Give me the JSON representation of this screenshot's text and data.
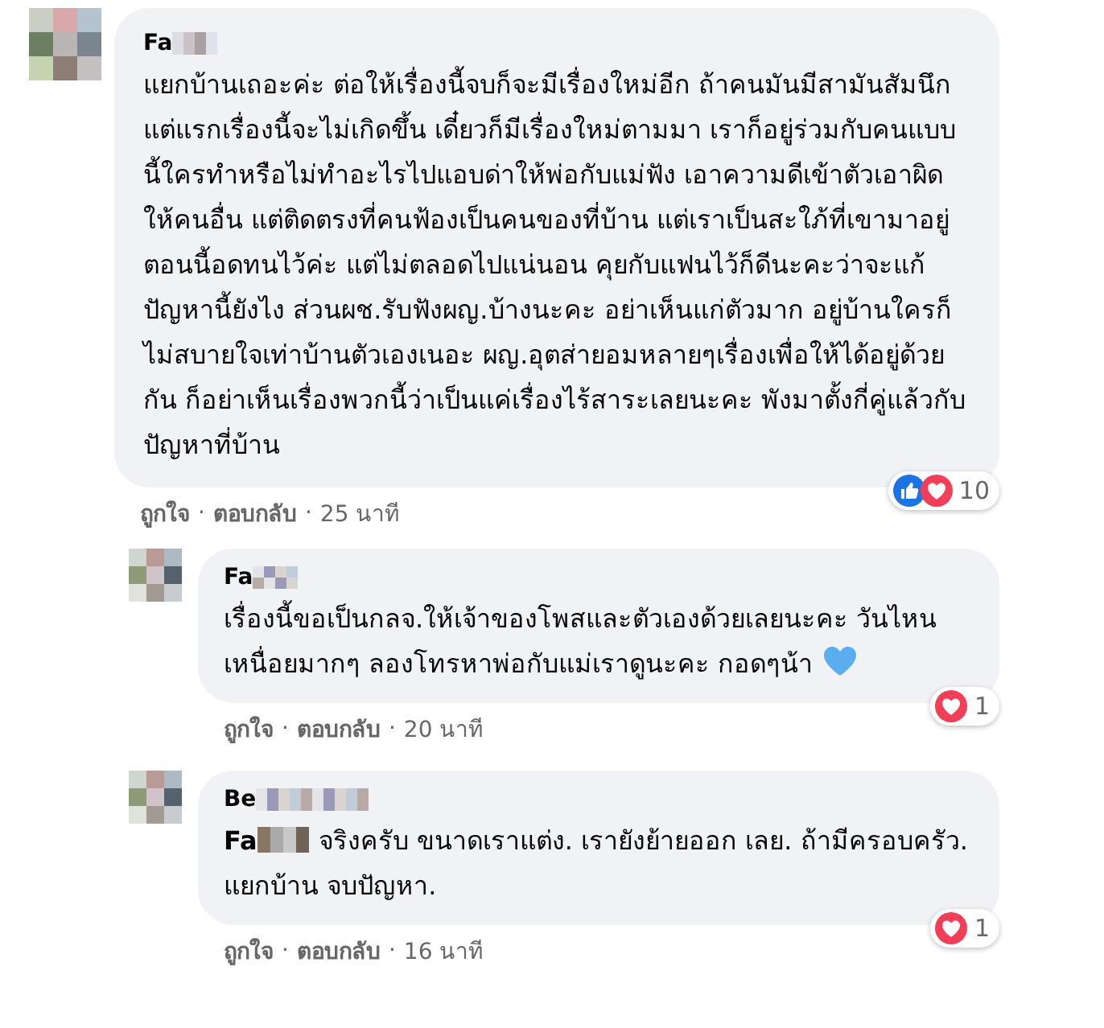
{
  "comments": [
    {
      "author": "Fa",
      "text": "แยกบ้านเถอะค่ะ ต่อให้เรื่องนี้จบก็จะมีเรื่องใหม่อีก ถ้าคนมันมีสามันสัมนึกแต่แรกเรื่องนี้จะไม่เกิดขึ้น เดี๋ยวก็มีเรื่องใหม่ตามมา เราก็อยู่ร่วมกับคนแบบนี้ใครทำหรือไม่ทำอะไรไปแอบด่าให้พ่อกับแม่ฟัง เอาความดีเข้าตัวเอาผิดให้คนอื่น แต่ติดตรงที่คนฟ้องเป็นคนของที่บ้าน แต่เราเป็นสะใภ้ที่เขามาอยู่ ตอนนี้อดทนไว้ค่ะ แต่ไม่ตลอดไปแน่นอน คุยกับแฟนไว้ก็ดีนะคะว่าจะแก้ปัญหานี้ยังไง ส่วนผช.รับฟังผญ.บ้างนะคะ อย่าเห็นแก่ตัวมาก อยู่บ้านใครก็ไม่สบายใจเท่าบ้านตัวเองเนอะ ผญ.อุตส่ายอมหลายๆเรื่องเพื่อให้ได้อยู่ด้วยกัน ก็อย่าเห็นเรื่องพวกนี้ว่าเป็นแค่เรื่องไร้สาระเลยนะคะ พังมาตั้งกี่คู่แล้วกับปัญหาที่บ้าน",
      "reactions": [
        {
          "kind": "like"
        },
        {
          "kind": "love"
        }
      ],
      "count": "10",
      "actions": [
        "ถูกใจ",
        "ตอบกลับ"
      ],
      "separator": "·",
      "time": "25 นาที",
      "replies": [
        {
          "author": "Fa",
          "text": "เรื่องนี้ขอเป็นกลจ.ให้เจ้าของโพสและตัวเองด้วยเลยนะคะ วันไหนเหนื่อยมากๆ ลองโทรหาพ่อกับแม่เราดูนะคะ กอดๆน้า",
          "heart": true,
          "reactions": [
            {
              "kind": "love"
            }
          ],
          "count": "1",
          "actions": [
            "ถูกใจ",
            "ตอบกลับ"
          ],
          "separator": "·",
          "time": "20 นาที"
        },
        {
          "author": "Be",
          "mention": "Fa",
          "text": "จริงครับ ขนาดเราแต่ง. เรายังย้ายออก เลย. ถ้ามีครอบครัว. แยกบ้าน จบปัญหา.",
          "heart": false,
          "reactions": [
            {
              "kind": "love"
            }
          ],
          "count": "1",
          "actions": [
            "ถูกใจ",
            "ตอบกลับ"
          ],
          "separator": "·",
          "time": "16 นาที"
        }
      ]
    }
  ]
}
